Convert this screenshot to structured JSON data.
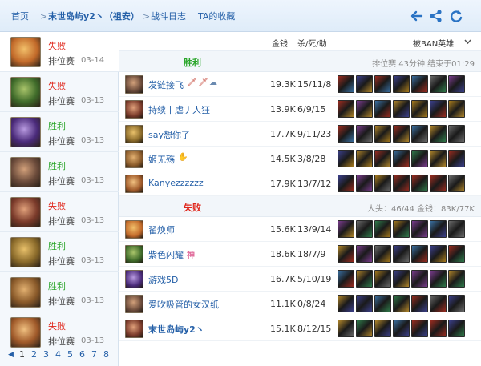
{
  "nav": {
    "crumbs": [
      "首页",
      "末世岛屿y2丶（祖安）",
      "战斗日志",
      "TA的收藏"
    ],
    "seps": [
      ">",
      ">",
      ">"
    ]
  },
  "toolbar": {
    "icons": [
      "back-arrow-icon",
      "share-icon",
      "refresh-icon"
    ],
    "accent": "#2a73c4"
  },
  "matches": [
    {
      "result": "失败",
      "mode": "排位赛",
      "date": "03-14",
      "active": true
    },
    {
      "result": "失败",
      "mode": "排位赛",
      "date": "03-13"
    },
    {
      "result": "胜利",
      "mode": "排位赛",
      "date": "03-13"
    },
    {
      "result": "胜利",
      "mode": "排位赛",
      "date": "03-13"
    },
    {
      "result": "失败",
      "mode": "排位赛",
      "date": "03-13"
    },
    {
      "result": "胜利",
      "mode": "排位赛",
      "date": "03-13"
    },
    {
      "result": "胜利",
      "mode": "排位赛",
      "date": "03-13"
    },
    {
      "result": "失败",
      "mode": "排位赛",
      "date": "03-13"
    }
  ],
  "pager": {
    "prev": "◀",
    "pages": [
      "1",
      "2",
      "3",
      "4",
      "5",
      "6",
      "7",
      "8"
    ],
    "current": "1"
  },
  "columns": {
    "gold": "金钱",
    "kda": "杀/死/助",
    "filter": "被BAN英雄",
    "filter_icon": "chevron-down-icon"
  },
  "teams": [
    {
      "label": "胜利",
      "info": "排位赛 43分钟 结束于01:29",
      "color": "#2aa62a",
      "players": [
        {
          "name": "发链接飞",
          "gold": "19.3K",
          "kda": "15/11/8",
          "badges": [
            "sword-badge-icon",
            "sword-badge-icon",
            "cloud-badge-icon"
          ]
        },
        {
          "name": "持续丨虐丿人狂",
          "gold": "13.9K",
          "kda": "6/9/15",
          "badges": []
        },
        {
          "name": "say想你了",
          "gold": "17.7K",
          "kda": "9/11/23",
          "badges": []
        },
        {
          "name": "姬无殇",
          "gold": "14.5K",
          "kda": "3/8/28",
          "badges": [
            "hand-badge-icon"
          ]
        },
        {
          "name": "Kanyezzzzzz",
          "gold": "17.9K",
          "kda": "13/7/12",
          "badges": []
        }
      ]
    },
    {
      "label": "失败",
      "info": "人头：46/44 金钱：83K/77K",
      "color": "#e0261b",
      "players": [
        {
          "name": "翟焕师",
          "gold": "15.6K",
          "kda": "13/9/14",
          "badges": []
        },
        {
          "name": "紫色闪耀",
          "gold": "18.6K",
          "kda": "18/7/9",
          "badges": [
            "god-badge-icon"
          ]
        },
        {
          "name": "游戏5D",
          "gold": "16.7K",
          "kda": "5/10/19",
          "badges": []
        },
        {
          "name": "爱吹吸管的女汉纸",
          "gold": "11.1K",
          "kda": "0/8/24",
          "badges": []
        },
        {
          "name": "末世岛屿y2丶",
          "gold": "15.1K",
          "kda": "8/12/15",
          "badges": []
        }
      ]
    }
  ],
  "item_palette": [
    "#3b3f8a",
    "#b0852a",
    "#6a6a6a",
    "#9a2c20",
    "#3a6fa0",
    "#7a3c8e",
    "#2f7a4a",
    "#a67a1d"
  ]
}
